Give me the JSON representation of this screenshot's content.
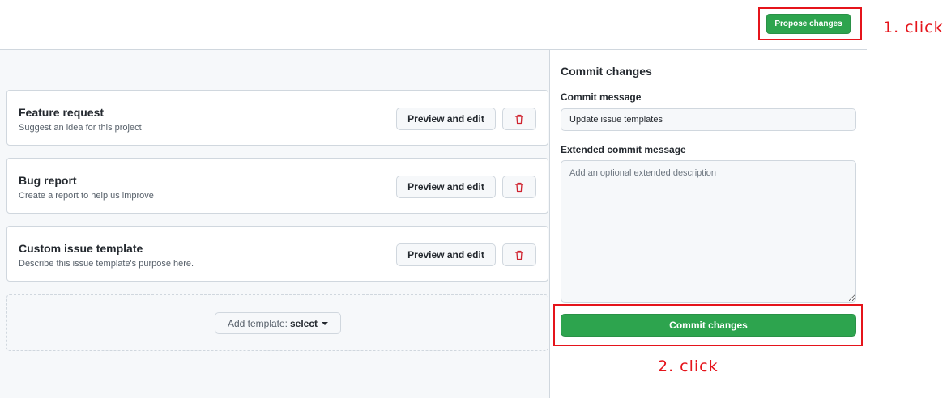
{
  "header": {
    "propose_button": "Propose changes"
  },
  "annotations": {
    "step1": "1. click",
    "step2": "2. click",
    "highlight_color": "#e5141b"
  },
  "templates": [
    {
      "title": "Feature request",
      "description": "Suggest an idea for this project",
      "preview_label": "Preview and edit",
      "delete_icon": "trash-icon"
    },
    {
      "title": "Bug report",
      "description": "Create a report to help us improve",
      "preview_label": "Preview and edit",
      "delete_icon": "trash-icon"
    },
    {
      "title": "Custom issue template",
      "description": "Describe this issue template's purpose here.",
      "preview_label": "Preview and edit",
      "delete_icon": "trash-icon"
    }
  ],
  "add_template": {
    "label": "Add template:",
    "selected": "select"
  },
  "commit": {
    "heading": "Commit changes",
    "message_label": "Commit message",
    "message_value": "Update issue templates",
    "extended_label": "Extended commit message",
    "extended_placeholder": "Add an optional extended description",
    "button_label": "Commit changes"
  },
  "colors": {
    "primary_green": "#2da44e",
    "danger_red": "#cf222e"
  }
}
